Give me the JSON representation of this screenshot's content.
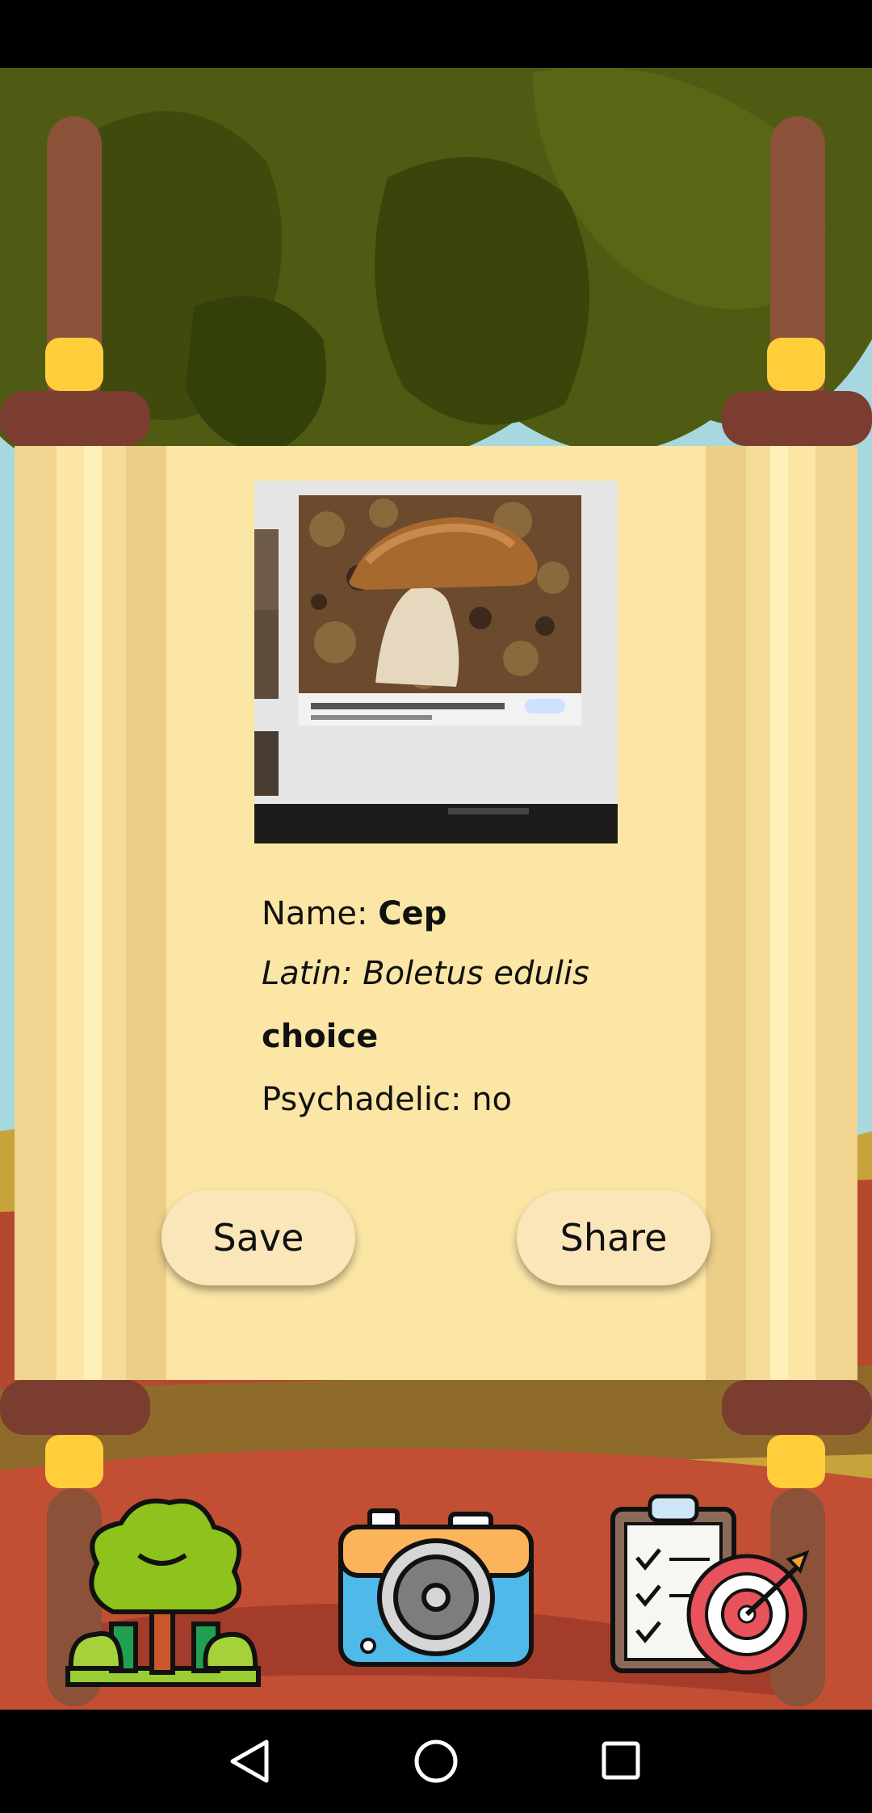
{
  "result": {
    "name_label": "Name: ",
    "name_value": "Cep",
    "latin": "Latin: Boletus edulis",
    "edibility": "choice",
    "psychedelic": "Psychadelic: no"
  },
  "buttons": {
    "save_label": "Save",
    "share_label": "Share"
  },
  "toolbar": {
    "icons": [
      "forest-icon",
      "camera-icon",
      "clipboard-target-icon"
    ]
  },
  "colors": {
    "paper": "#fbe6a5",
    "button": "#fbe6b9",
    "rod": "#7a3d30",
    "ring": "#ffce3a"
  }
}
